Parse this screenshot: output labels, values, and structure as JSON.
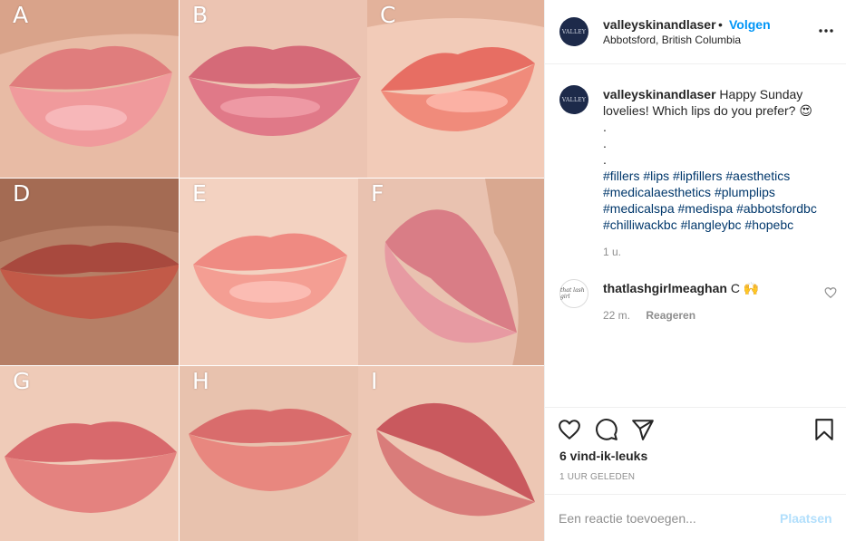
{
  "colors": {
    "link": "#0095f6",
    "hashtag": "#00376b",
    "muted": "#8e8e8e",
    "text": "#262626",
    "post_button_disabled": "#b2dffc",
    "avatar_bg": "#1d2a4a"
  },
  "photo": {
    "tiles": [
      {
        "label": "A"
      },
      {
        "label": "B"
      },
      {
        "label": "C"
      },
      {
        "label": "D"
      },
      {
        "label": "E"
      },
      {
        "label": "F"
      },
      {
        "label": "G"
      },
      {
        "label": "H"
      },
      {
        "label": "I"
      }
    ]
  },
  "header": {
    "username": "valleyskinandlaser",
    "separator": "•",
    "follow_label": "Volgen",
    "location": "Abbotsford, British Columbia",
    "avatar_text": "VALLEY",
    "more_icon": "more-horizontal-icon"
  },
  "caption": {
    "username": "valleyskinandlaser",
    "text": "Happy Sunday lovelies! Which lips do you prefer? 😍",
    "dots": [
      ".",
      ".",
      "."
    ],
    "hashtags": "#fillers #lips #lipfillers #aesthetics #medicalaesthetics #plumplips #medicalspa #medispa #abbotsfordbc #chilliwackbc #langleybc #hopebc",
    "age": "1 u."
  },
  "comment": {
    "username": "thatlashgirlmeaghan",
    "text": "C 🙌",
    "age": "22 m.",
    "reply_label": "Reageren",
    "avatar_text": "that lash girl"
  },
  "actions": {
    "icons": [
      "heart-icon",
      "comment-icon",
      "share-icon",
      "bookmark-icon"
    ],
    "likes": "6 vind-ik-leuks",
    "time_ago": "1 UUR GELEDEN"
  },
  "add_comment": {
    "placeholder": "Een reactie toevoegen...",
    "post_label": "Plaatsen"
  }
}
